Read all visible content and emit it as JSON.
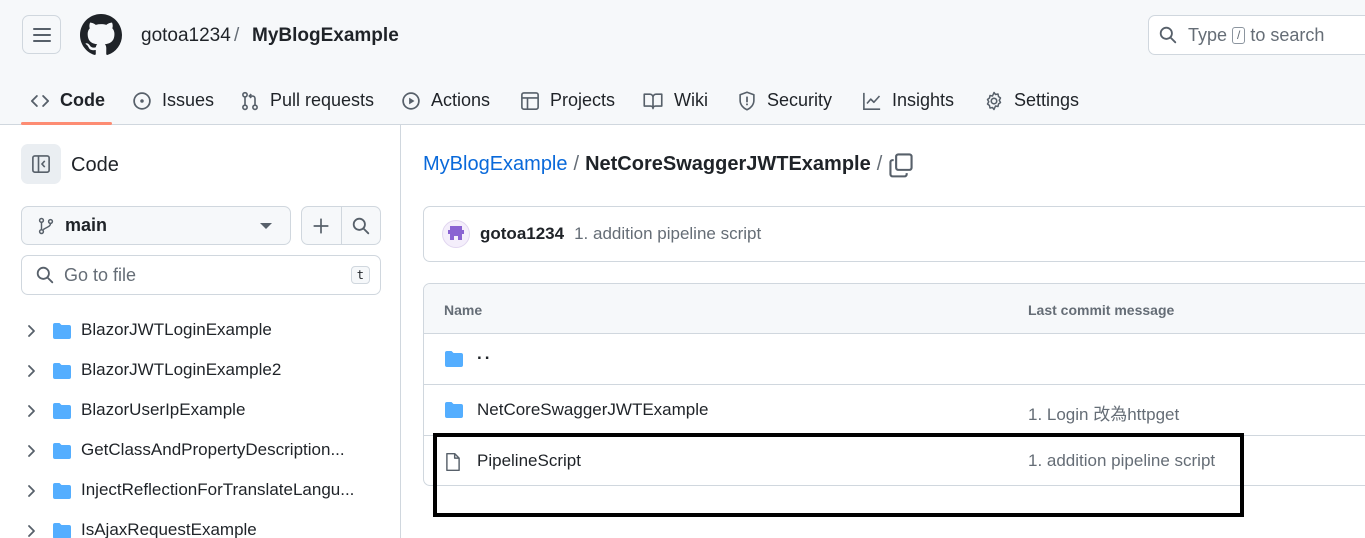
{
  "header": {
    "owner": "gotoa1234",
    "separator": "/",
    "repo": "MyBlogExample",
    "search_prefix": "Type",
    "search_key": "/",
    "search_suffix": "to search"
  },
  "tabs": [
    {
      "label": "Code",
      "icon": "code-icon"
    },
    {
      "label": "Issues",
      "icon": "issue-icon"
    },
    {
      "label": "Pull requests",
      "icon": "pull-request-icon"
    },
    {
      "label": "Actions",
      "icon": "play-icon"
    },
    {
      "label": "Projects",
      "icon": "table-icon"
    },
    {
      "label": "Wiki",
      "icon": "book-icon"
    },
    {
      "label": "Security",
      "icon": "shield-icon"
    },
    {
      "label": "Insights",
      "icon": "graph-icon"
    },
    {
      "label": "Settings",
      "icon": "gear-icon"
    }
  ],
  "sidebar": {
    "title": "Code",
    "branch": "main",
    "goto_placeholder": "Go to file",
    "goto_key": "t",
    "items": [
      {
        "label": "BlazorJWTLoginExample"
      },
      {
        "label": "BlazorJWTLoginExample2"
      },
      {
        "label": "BlazorUserIpExample"
      },
      {
        "label": "GetClassAndPropertyDescription..."
      },
      {
        "label": "InjectReflectionForTranslateLangu..."
      },
      {
        "label": "IsAjaxRequestExample"
      }
    ]
  },
  "main": {
    "path_root": "MyBlogExample",
    "path_sep": "/",
    "path_current": "NetCoreSwaggerJWTExample",
    "path_trailing": "/",
    "commit": {
      "author": "gotoa1234",
      "message": "1. addition pipeline script"
    },
    "table": {
      "col_name": "Name",
      "col_message": "Last commit message",
      "parent": "..",
      "rows": [
        {
          "type": "folder",
          "name": "NetCoreSwaggerJWTExample",
          "message": "1. Login 改為httpget"
        },
        {
          "type": "file",
          "name": "PipelineScript",
          "message": "1. addition pipeline script"
        }
      ]
    }
  },
  "colors": {
    "accent_link": "#0969da",
    "tab_underline": "#fd8c73",
    "folder": "#54aeff",
    "highlight_box": "#000000"
  }
}
